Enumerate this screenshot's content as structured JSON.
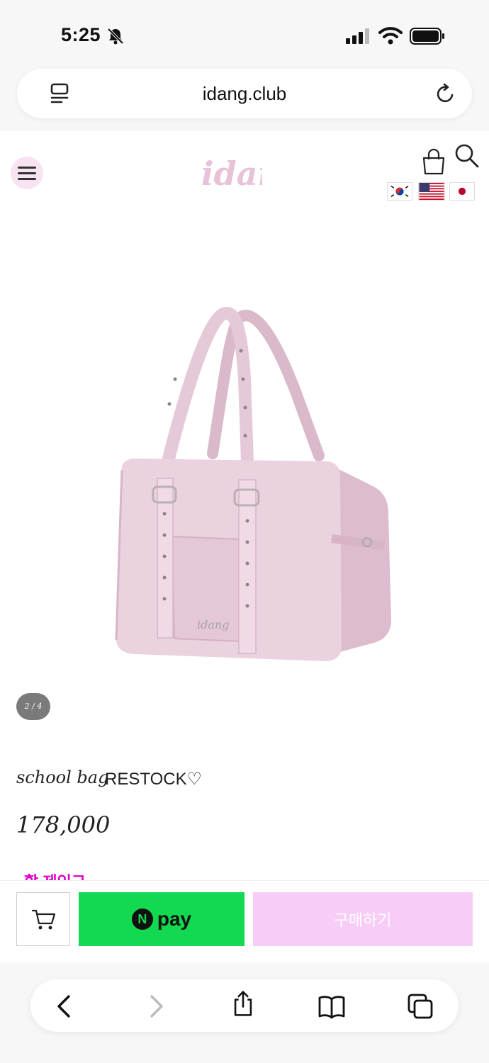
{
  "status_bar": {
    "time": "5:25"
  },
  "browser": {
    "url": "idang.club",
    "toolbar_icons": [
      "back-icon",
      "forward-icon",
      "share-icon",
      "bookmarks-icon",
      "tabs-icon"
    ]
  },
  "header": {
    "logo_text": "idang",
    "flags": [
      "korea-flag-icon",
      "usa-flag-icon",
      "japan-flag-icon"
    ]
  },
  "product": {
    "image_counter": "2 / 4",
    "name_script": "school bag",
    "name_badge": "RESTOCK♡",
    "price": "178,000",
    "discount_peek": "할 제인그"
  },
  "purchase_bar": {
    "npay_logo": "N",
    "npay_label": "pay",
    "buy_label": "구매하기"
  },
  "colors": {
    "accent_pink": "#f7cdf7",
    "npay_green": "#12d94f",
    "bag_pink": "#e9cedb",
    "discount_magenta": "#e000c8"
  }
}
